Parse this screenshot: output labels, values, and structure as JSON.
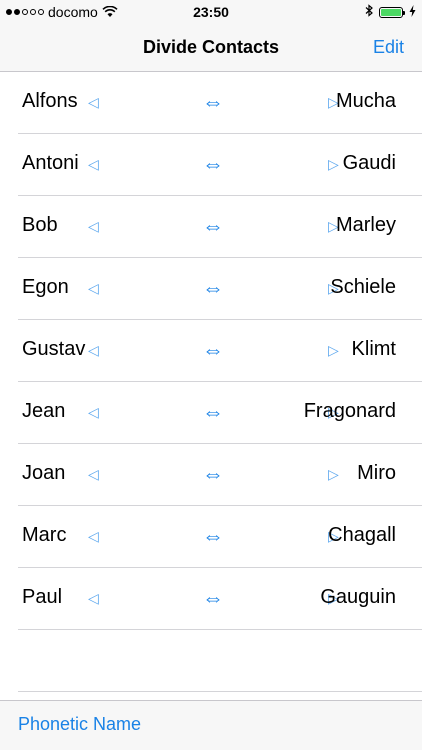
{
  "status_bar": {
    "carrier": "docomo",
    "time": "23:50",
    "signal_bars_filled": 2,
    "signal_bars_total": 5,
    "battery_level": 1.0,
    "battery_color": "#4cd964"
  },
  "nav": {
    "title": "Divide Contacts",
    "edit_label": "Edit"
  },
  "icons": {
    "left_arrow": "◁",
    "right_arrow": "▷",
    "swap": "⇔"
  },
  "contacts": [
    {
      "first": "Alfons",
      "last": "Mucha"
    },
    {
      "first": "Antoni",
      "last": "Gaudi"
    },
    {
      "first": "Bob",
      "last": "Marley"
    },
    {
      "first": "Egon",
      "last": "Schiele"
    },
    {
      "first": "Gustav",
      "last": "Klimt"
    },
    {
      "first": "Jean",
      "last": "Fragonard"
    },
    {
      "first": "Joan",
      "last": "Miro"
    },
    {
      "first": "Marc",
      "last": "Chagall"
    },
    {
      "first": "Paul",
      "last": "Gauguin"
    }
  ],
  "toolbar": {
    "phonetic_label": "Phonetic Name"
  },
  "colors": {
    "accent": "#1a82e6",
    "arrow": "#5aa6ee",
    "separator": "#d4d4d8",
    "bar_background": "#f7f7f7"
  }
}
